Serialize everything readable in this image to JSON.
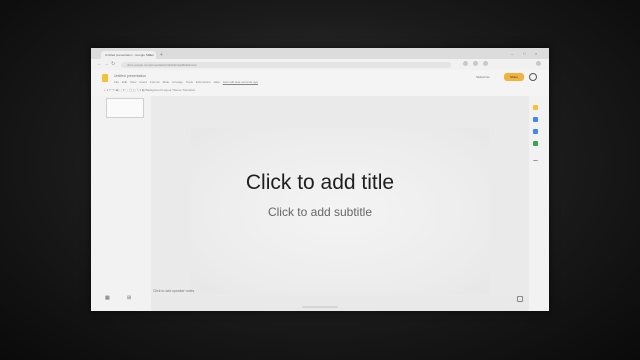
{
  "browser": {
    "tab_title": "Untitled presentation - Google Slides",
    "tab_close": "×",
    "new_tab": "+",
    "window_controls": [
      "–",
      "□",
      "×"
    ],
    "nav": [
      "←",
      "→",
      "↻"
    ],
    "url": "docs.google.com/presentation/d/1abc/edit#slide=id.p"
  },
  "app": {
    "doc_title": "Untitled presentation",
    "menu": [
      "File",
      "Edit",
      "View",
      "Insert",
      "Format",
      "Slide",
      "Arrange",
      "Tools",
      "Extensions",
      "Help",
      "Last edit was seconds ago"
    ],
    "toolbar": "+ ▾  ↶ ↷ 🖶  ⬚ ▾  ⬚ ◯ ▢ ╲ ▾  ▤  Background  Layout  Theme  Transition",
    "present_label": "Slideshow",
    "share_label": "Share"
  },
  "slide": {
    "title_placeholder": "Click to add title",
    "subtitle_placeholder": "Click to add subtitle"
  },
  "notes_placeholder": "Click to add speaker notes",
  "bottom_controls": [
    "▦",
    "⊞"
  ],
  "side_icons": [
    {
      "name": "keep-icon",
      "color": "#f3c236"
    },
    {
      "name": "tasks-icon",
      "color": "#4285f4"
    },
    {
      "name": "contacts-icon",
      "color": "#4285f4"
    },
    {
      "name": "maps-icon",
      "color": "#34a853"
    },
    {
      "name": "add-icon",
      "color": "#888888"
    }
  ]
}
